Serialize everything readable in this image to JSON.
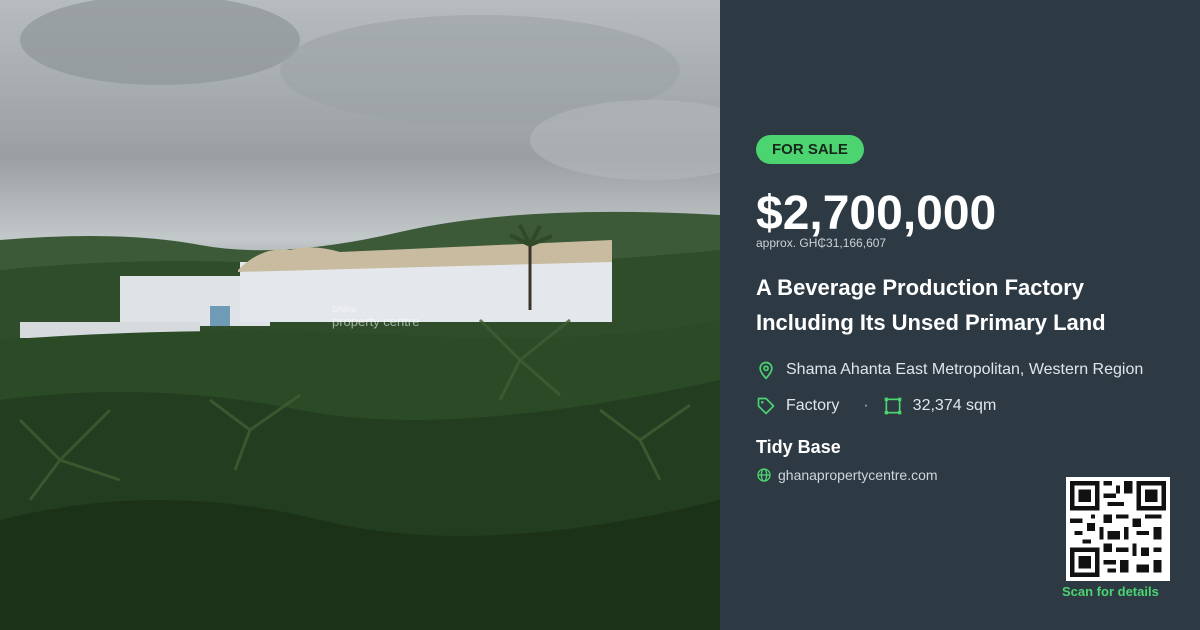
{
  "photo": {
    "watermark_line1": "Ghana",
    "watermark_line2": "property centre"
  },
  "listing": {
    "status": "FOR SALE",
    "price": "$2,700,000",
    "approx_price": "approx. GH₵31,166,607",
    "title": "A Beverage Production Factory Including Its Unsed Primary Land",
    "location": "Shama Ahanta East Metropolitan, Western Region",
    "type": "Factory",
    "area": "32,374 sqm",
    "agent": "Tidy Base",
    "website": "ghanapropertycentre.com",
    "scan_label": "Scan for details"
  },
  "colors": {
    "panel": "#2d3a44",
    "accent": "#4cd471"
  },
  "icons": [
    "map-pin-icon",
    "tag-icon",
    "area-icon",
    "globe-icon",
    "qr-code"
  ]
}
